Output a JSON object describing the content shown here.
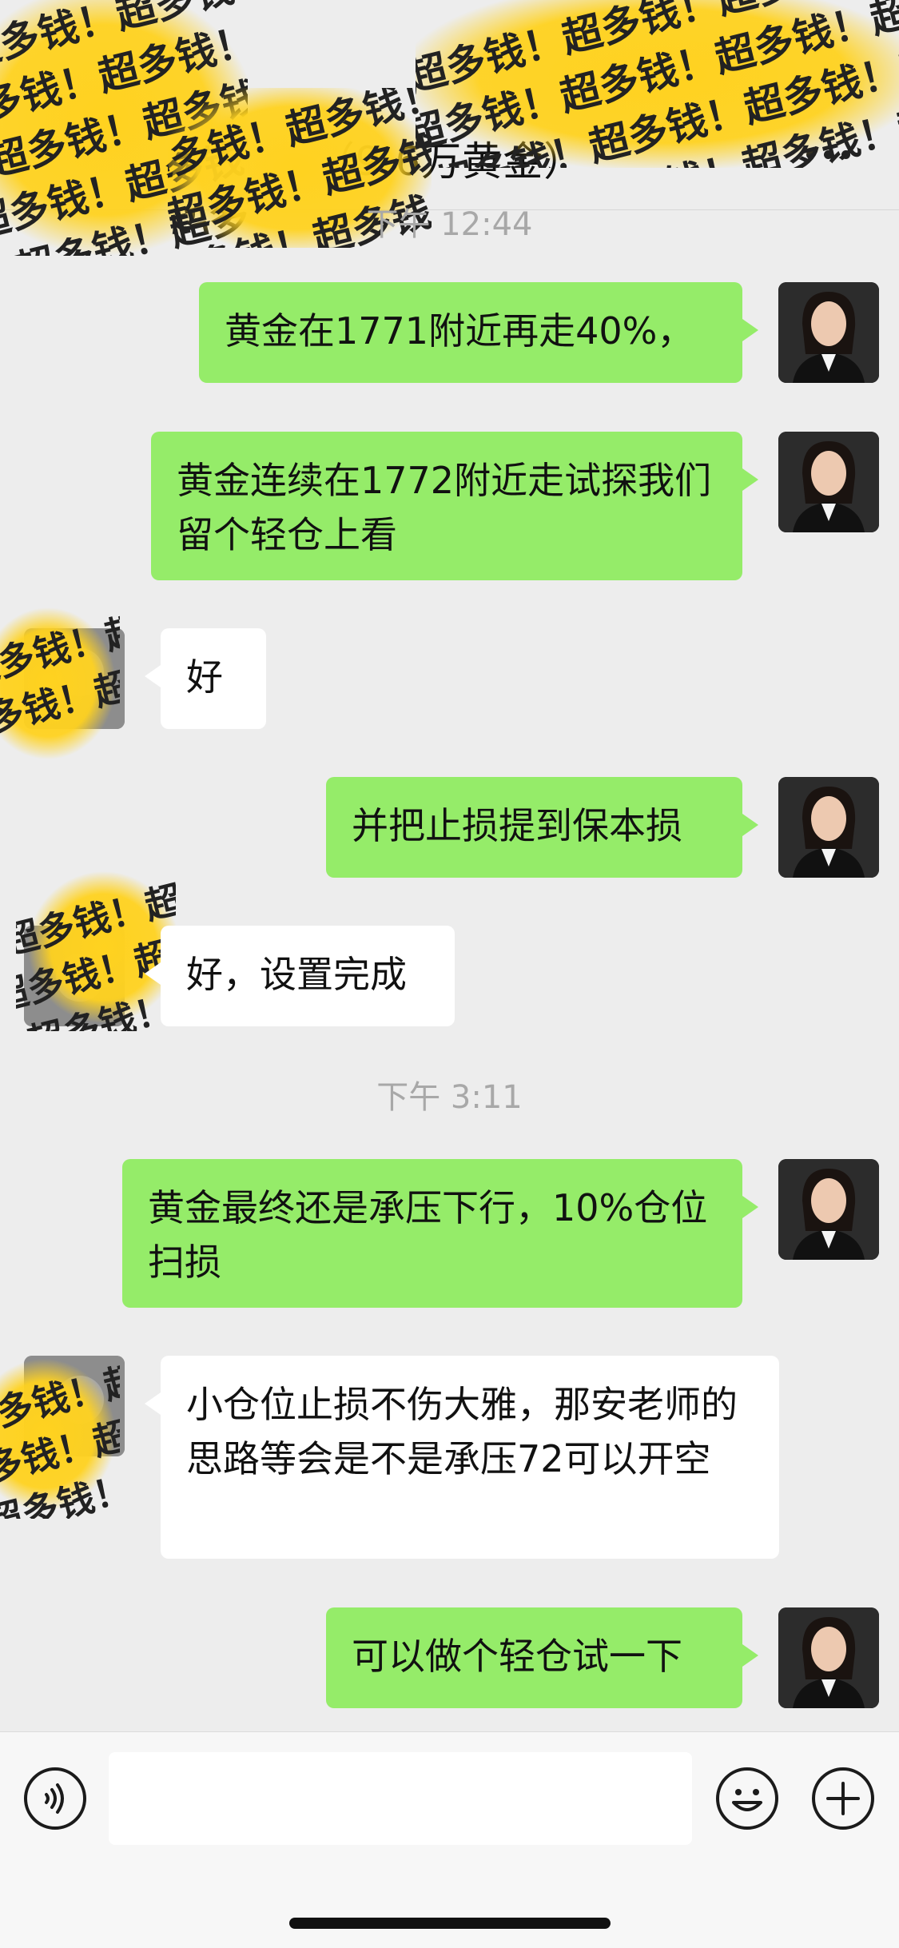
{
  "header": {
    "title": "（9.6万黄金）",
    "more_icon": "more-dots-icon"
  },
  "watermark": {
    "text": "超多钱！超多钱！超多钱！超多钱！超多钱！超多钱！"
  },
  "timestamps": [
    "下午 12:44",
    "下午 3:11"
  ],
  "messages": [
    {
      "side": "me",
      "text": "黄金在1771附近再走40%，"
    },
    {
      "side": "me",
      "text": "黄金连续在1772附近走试探我们留个轻仓上看"
    },
    {
      "side": "other",
      "text": "好"
    },
    {
      "side": "me",
      "text": "并把止损提到保本损"
    },
    {
      "side": "other",
      "text": "好，设置完成"
    },
    {
      "side": "me",
      "text": "黄金最终还是承压下行，10%仓位扫损"
    },
    {
      "side": "other",
      "text": "小仓位止损不伤大雅，那安老师的思路等会是不是承压72可以开空"
    },
    {
      "side": "me",
      "text": "可以做个轻仓试一下"
    }
  ],
  "input_bar": {
    "voice_icon": "voice-icon",
    "emoji_icon": "emoji-icon",
    "plus_icon": "plus-icon",
    "input_value": ""
  },
  "colors": {
    "background": "#ededed",
    "my_bubble": "#95ec69",
    "other_bubble": "#ffffff",
    "watermark_yellow": "#ffd21f"
  }
}
